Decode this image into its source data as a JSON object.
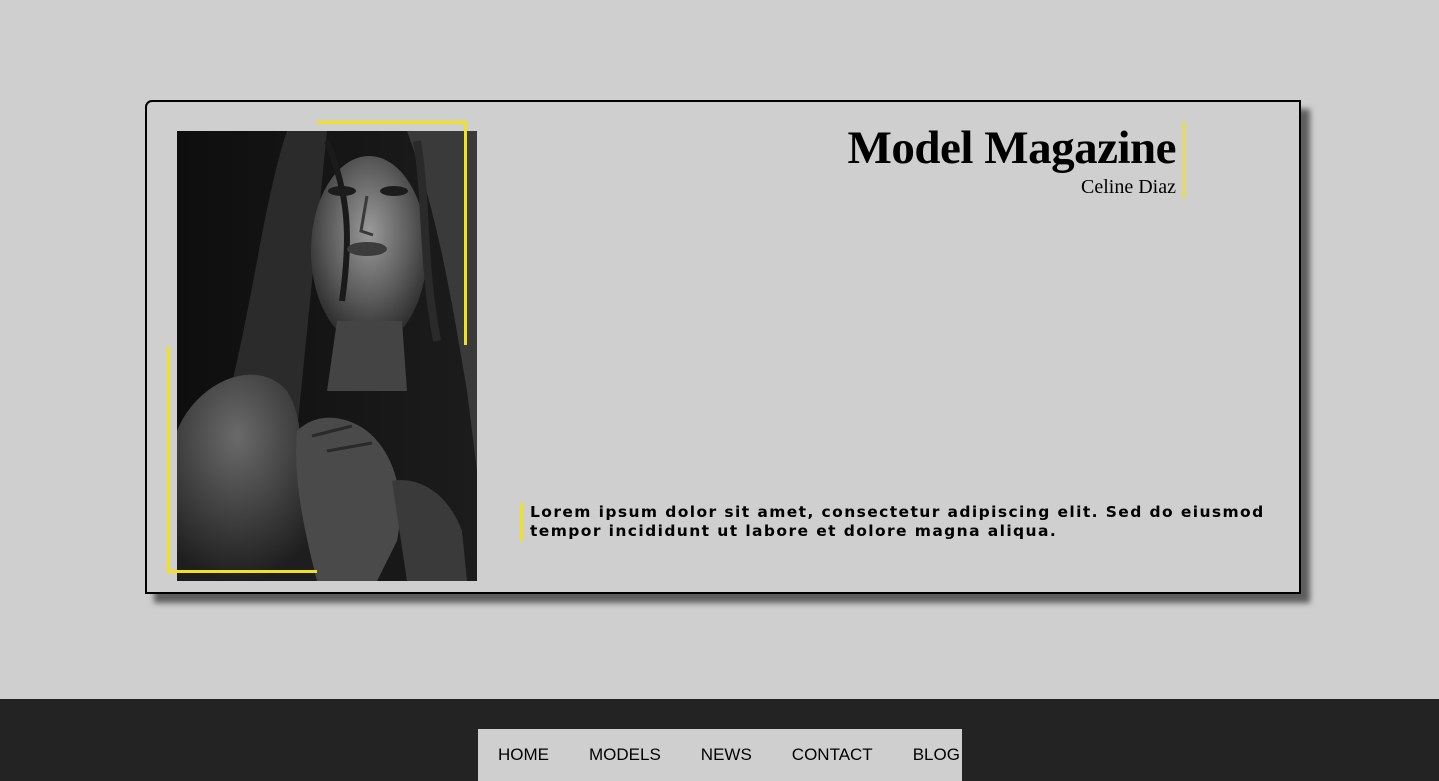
{
  "header": {
    "title": "Model Magazine",
    "subtitle": "Celine Diaz"
  },
  "main": {
    "description": "Lorem ipsum dolor sit amet, consectetur adipiscing elit. Sed do eiusmod tempor incididunt ut labore et dolore magna aliqua.",
    "photo_icon": "portrait-photo"
  },
  "nav": {
    "items": [
      {
        "label": "HOME"
      },
      {
        "label": "MODELS"
      },
      {
        "label": "NEWS"
      },
      {
        "label": "CONTACT"
      },
      {
        "label": "BLOG"
      }
    ]
  },
  "colors": {
    "background": "#cfcfcf",
    "accent": "#f2e21e",
    "footer": "#232323",
    "text": "#000000"
  }
}
